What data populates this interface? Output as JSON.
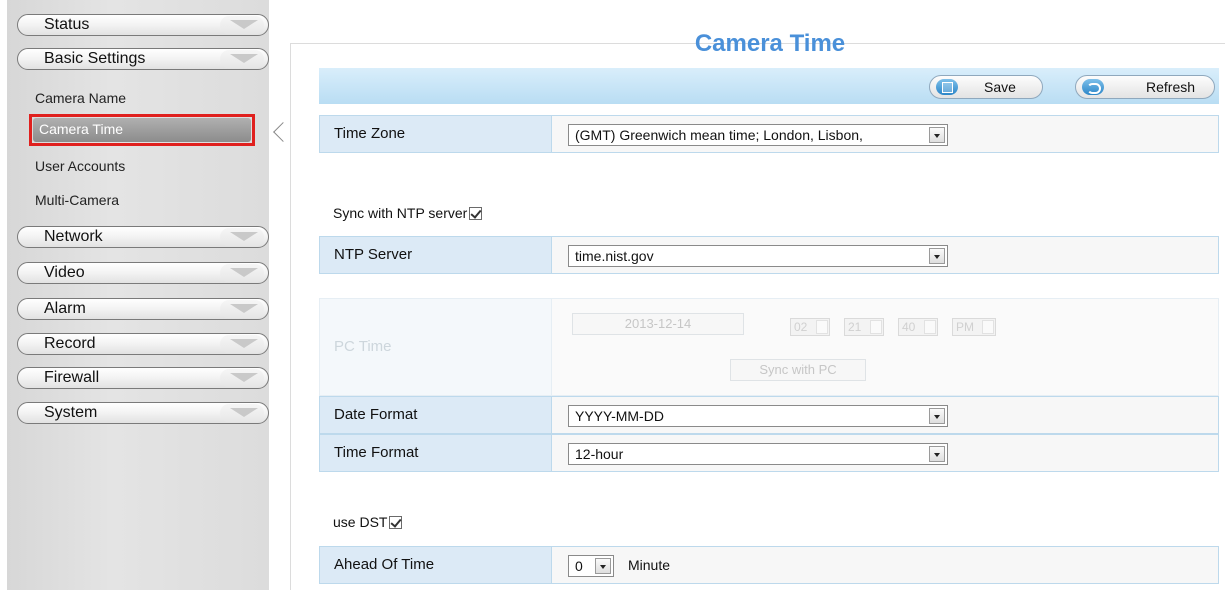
{
  "sidebar": {
    "menus": [
      "Status",
      "Basic Settings"
    ],
    "submenu": [
      "Camera Name",
      "Camera Time",
      "User Accounts",
      "Multi-Camera"
    ],
    "active_submenu": "Camera Time",
    "menus_after": [
      "Network",
      "Video",
      "Alarm",
      "Record",
      "Firewall",
      "System"
    ]
  },
  "page": {
    "title": "Camera Time"
  },
  "toolbar": {
    "save_label": "Save",
    "refresh_label": "Refresh"
  },
  "form": {
    "time_zone": {
      "label": "Time Zone",
      "value": "(GMT) Greenwich mean time; London, Lisbon,"
    },
    "sync_ntp": {
      "label": "Sync with NTP server",
      "checked": true
    },
    "ntp_server": {
      "label": "NTP Server",
      "value": "time.nist.gov"
    },
    "pc_time": {
      "label": "PC Time",
      "date": "2013-12-14",
      "hour": "02",
      "minute": "21",
      "second": "40",
      "ampm": "PM",
      "sync_button": "Sync with PC",
      "disabled": true
    },
    "date_format": {
      "label": "Date Format",
      "value": "YYYY-MM-DD"
    },
    "time_format": {
      "label": "Time Format",
      "value": "12-hour"
    },
    "use_dst": {
      "label": "use DST",
      "checked": true
    },
    "ahead_of_time": {
      "label": "Ahead Of Time",
      "value": "0",
      "unit": "Minute"
    }
  },
  "colors": {
    "title_blue": "#4a90d9",
    "active_highlight": "#e0201e",
    "label_bg": "#dceaf6"
  }
}
